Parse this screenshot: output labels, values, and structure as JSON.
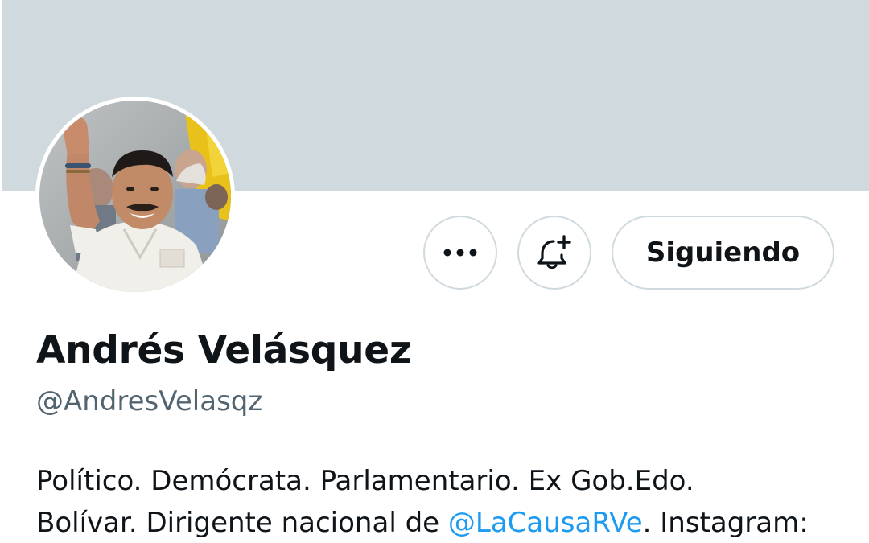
{
  "profile": {
    "display_name": "Andrés Velásquez",
    "handle": "@AndresVelasqz",
    "bio": {
      "line1": "Político. Demócrata. Parlamentario. Ex Gob.Edo.",
      "line2_before": "Bolívar. Dirigente nacional de ",
      "line2_mention": "@LaCausaRVe",
      "line2_after": ". Instagram:"
    }
  },
  "actions": {
    "more_icon": "more-horizontal-icon",
    "notify_icon": "bell-plus-icon",
    "follow_label": "Siguiendo"
  },
  "colors": {
    "banner": "#cfd9de",
    "text_primary": "#0f1419",
    "text_secondary": "#536471",
    "link": "#1d9bf0",
    "border": "#cfd9de"
  }
}
